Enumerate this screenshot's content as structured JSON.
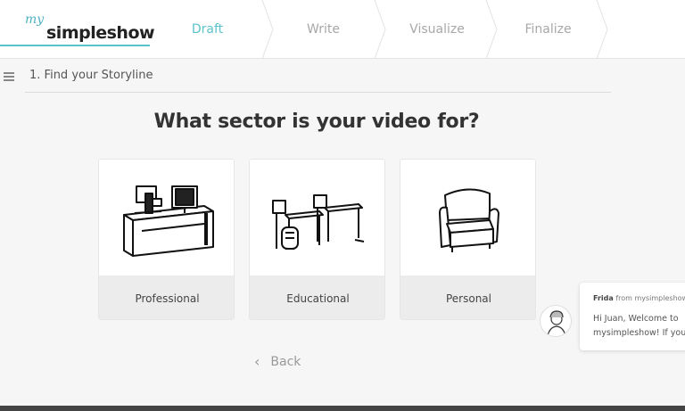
{
  "header": {
    "logo_prefix": "my",
    "logo_main": "simpleshow",
    "steps": [
      {
        "label": "Draft",
        "active": true
      },
      {
        "label": "Write",
        "active": false
      },
      {
        "label": "Visualize",
        "active": false
      },
      {
        "label": "Finalize",
        "active": false
      }
    ],
    "accent_color": "#5cc3cc"
  },
  "breadcrumb": {
    "number": "1.",
    "title": "Find your Storyline"
  },
  "main": {
    "question": "What sector is your video for?",
    "options": [
      {
        "label": "Professional",
        "icon": "office-desk-icon"
      },
      {
        "label": "Educational",
        "icon": "school-desks-icon"
      },
      {
        "label": "Personal",
        "icon": "armchair-icon"
      }
    ],
    "back_label": "Back"
  },
  "chat": {
    "sender": "Frida",
    "from_text": "from mysimpleshow",
    "message_line1": "Hi Juan, Welcome to",
    "message_line2": "mysimpleshow! If you"
  }
}
